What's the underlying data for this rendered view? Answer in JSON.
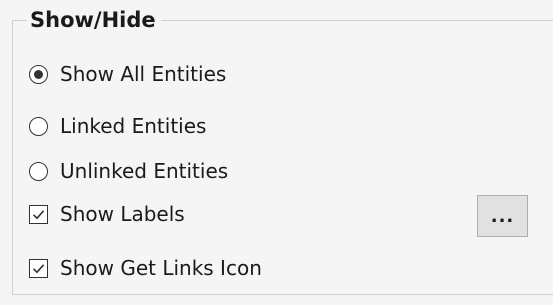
{
  "group": {
    "title": "Show/Hide"
  },
  "radios": [
    {
      "label": "Show All Entities",
      "selected": true
    },
    {
      "label": "Linked Entities",
      "selected": false
    },
    {
      "label": "Unlinked Entities",
      "selected": false
    }
  ],
  "checkboxes": [
    {
      "label": "Show Labels",
      "checked": true
    },
    {
      "label": "Show Get Links Icon",
      "checked": true
    }
  ],
  "buttons": {
    "more_label": "..."
  }
}
